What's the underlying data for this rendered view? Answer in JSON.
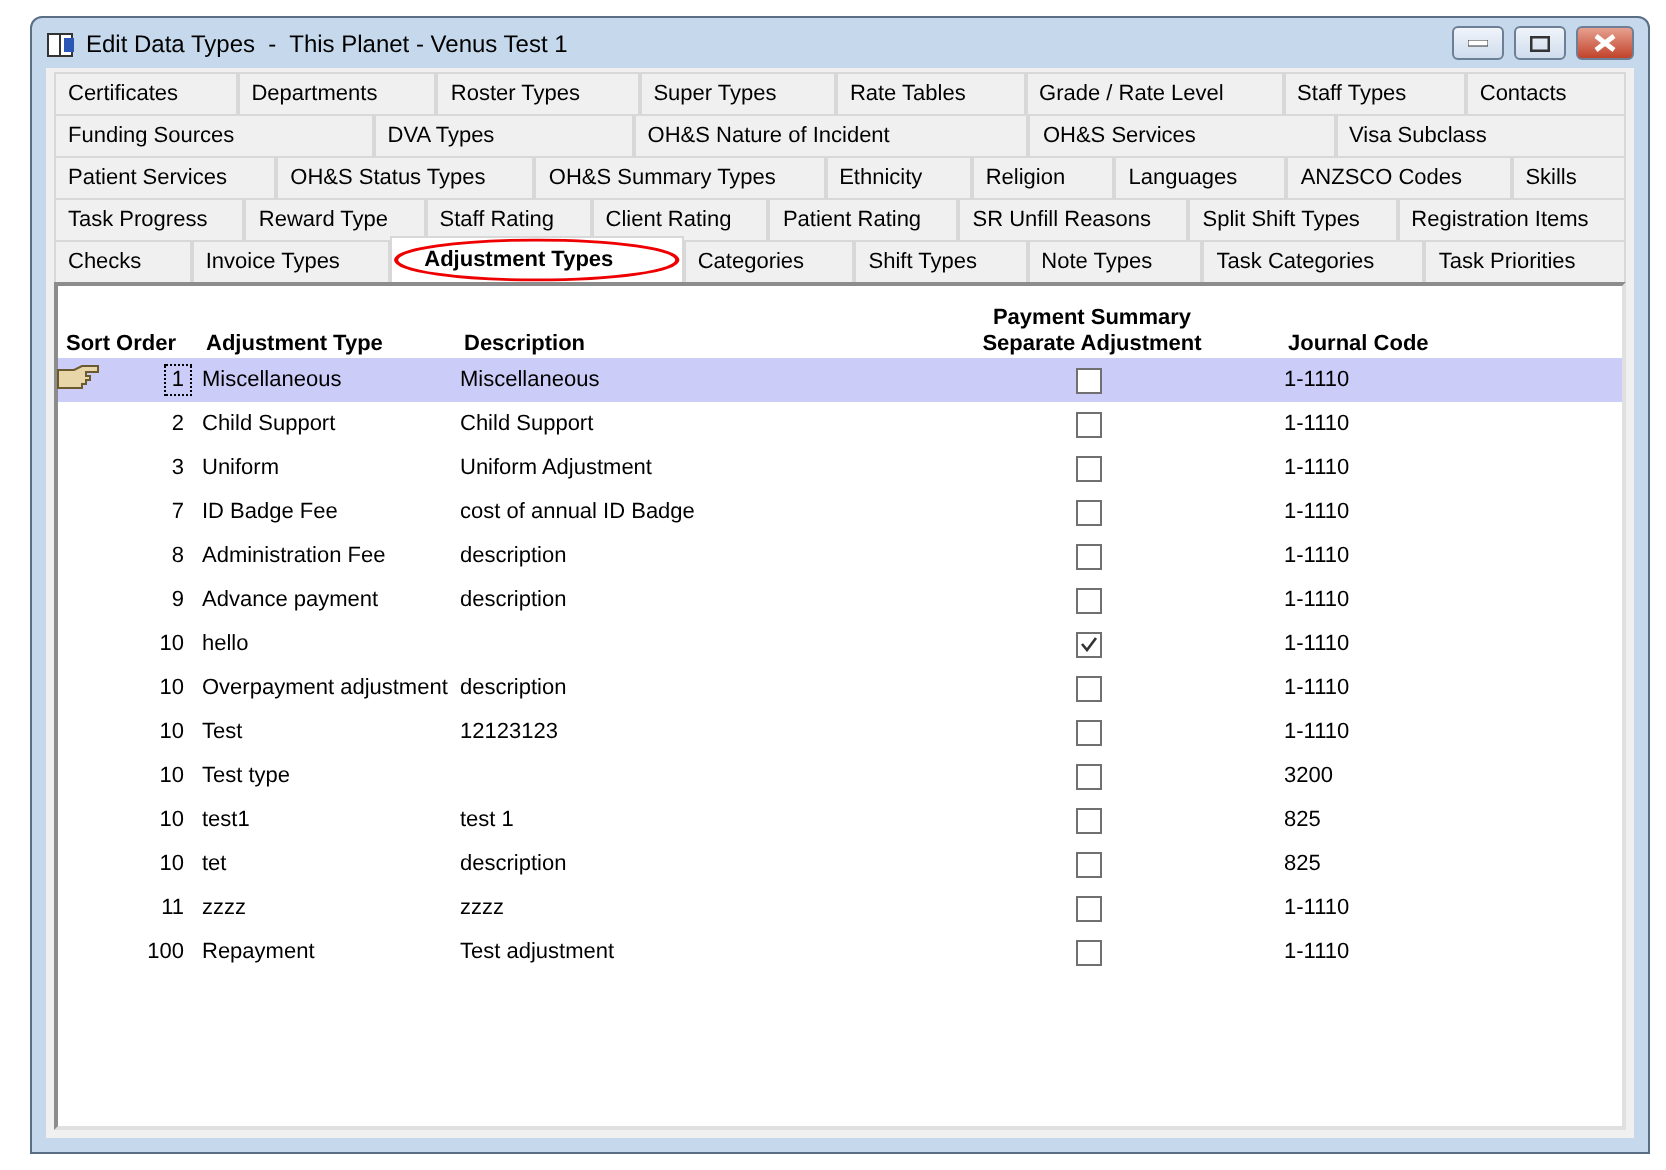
{
  "window": {
    "title": "Edit Data Types  -  This Planet - Venus Test 1"
  },
  "tab_rows": [
    [
      {
        "label": "Certificates",
        "selected": false
      },
      {
        "label": "Departments",
        "selected": false
      },
      {
        "label": "Roster Types",
        "selected": false
      },
      {
        "label": "Super Types",
        "selected": false
      },
      {
        "label": "Rate Tables",
        "selected": false
      },
      {
        "label": "Grade / Rate Level",
        "selected": false
      },
      {
        "label": "Staff Types",
        "selected": false
      },
      {
        "label": "Contacts",
        "selected": false
      }
    ],
    [
      {
        "label": "Funding Sources",
        "selected": false
      },
      {
        "label": "DVA Types",
        "selected": false
      },
      {
        "label": "OH&S Nature of Incident",
        "selected": false
      },
      {
        "label": "OH&S Services",
        "selected": false
      },
      {
        "label": "Visa Subclass",
        "selected": false
      }
    ],
    [
      {
        "label": "Patient Services",
        "selected": false
      },
      {
        "label": "OH&S Status Types",
        "selected": false
      },
      {
        "label": "OH&S Summary Types",
        "selected": false
      },
      {
        "label": "Ethnicity",
        "selected": false
      },
      {
        "label": "Religion",
        "selected": false
      },
      {
        "label": "Languages",
        "selected": false
      },
      {
        "label": "ANZSCO Codes",
        "selected": false
      },
      {
        "label": "Skills",
        "selected": false
      }
    ],
    [
      {
        "label": "Task Progress",
        "selected": false
      },
      {
        "label": "Reward Type",
        "selected": false
      },
      {
        "label": "Staff Rating",
        "selected": false
      },
      {
        "label": "Client Rating",
        "selected": false
      },
      {
        "label": "Patient Rating",
        "selected": false
      },
      {
        "label": "SR Unfill Reasons",
        "selected": false
      },
      {
        "label": "Split Shift Types",
        "selected": false
      },
      {
        "label": "Registration Items",
        "selected": false
      }
    ],
    [
      {
        "label": "Checks",
        "selected": false
      },
      {
        "label": "Invoice Types",
        "selected": false
      },
      {
        "label": "Adjustment Types",
        "selected": true
      },
      {
        "label": "Categories",
        "selected": false
      },
      {
        "label": "Shift Types",
        "selected": false
      },
      {
        "label": "Note Types",
        "selected": false
      },
      {
        "label": "Task Categories",
        "selected": false
      },
      {
        "label": "Task Priorities",
        "selected": false
      }
    ]
  ],
  "table": {
    "columns": [
      "Sort Order",
      "Adjustment Type",
      "Description",
      "Payment Summary\nSeparate Adjustment",
      "Journal Code"
    ],
    "rows": [
      {
        "sort_order": "1",
        "type": "Miscellaneous",
        "description": "Miscellaneous",
        "separate": false,
        "journal_code": "1-1110",
        "selected": true
      },
      {
        "sort_order": "2",
        "type": "Child Support",
        "description": "Child Support",
        "separate": false,
        "journal_code": "1-1110",
        "selected": false
      },
      {
        "sort_order": "3",
        "type": "Uniform",
        "description": "Uniform Adjustment",
        "separate": false,
        "journal_code": "1-1110",
        "selected": false
      },
      {
        "sort_order": "7",
        "type": "ID Badge Fee",
        "description": "cost of annual ID Badge",
        "separate": false,
        "journal_code": "1-1110",
        "selected": false
      },
      {
        "sort_order": "8",
        "type": "Administration Fee",
        "description": "description",
        "separate": false,
        "journal_code": "1-1110",
        "selected": false
      },
      {
        "sort_order": "9",
        "type": "Advance payment",
        "description": "description",
        "separate": false,
        "journal_code": "1-1110",
        "selected": false
      },
      {
        "sort_order": "10",
        "type": "hello",
        "description": "",
        "separate": true,
        "journal_code": "1-1110",
        "selected": false
      },
      {
        "sort_order": "10",
        "type": "Overpayment adjustment",
        "description": "description",
        "separate": false,
        "journal_code": "1-1110",
        "selected": false
      },
      {
        "sort_order": "10",
        "type": "Test",
        "description": "12123123",
        "separate": false,
        "journal_code": "1-1110",
        "selected": false
      },
      {
        "sort_order": "10",
        "type": "Test type",
        "description": "",
        "separate": false,
        "journal_code": "3200",
        "selected": false
      },
      {
        "sort_order": "10",
        "type": "test1",
        "description": "test 1",
        "separate": false,
        "journal_code": "825",
        "selected": false
      },
      {
        "sort_order": "10",
        "type": "tet",
        "description": "description",
        "separate": false,
        "journal_code": "825",
        "selected": false
      },
      {
        "sort_order": "11",
        "type": "zzzz",
        "description": "zzzz",
        "separate": false,
        "journal_code": "1-1110",
        "selected": false
      },
      {
        "sort_order": "100",
        "type": "Repayment",
        "description": "Test adjustment",
        "separate": false,
        "journal_code": "1-1110",
        "selected": false
      }
    ]
  }
}
